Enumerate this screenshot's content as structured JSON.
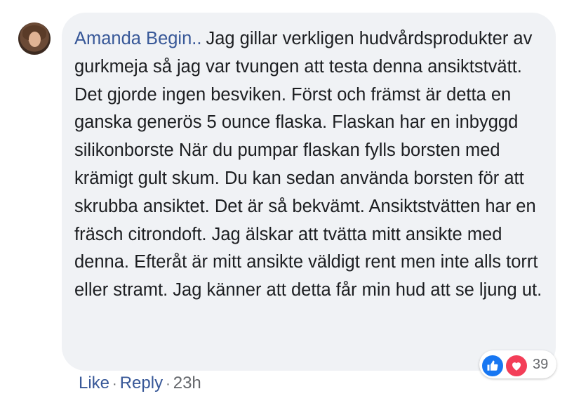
{
  "comment": {
    "author": "Amanda Begin..",
    "text": "Jag gillar verkligen hudvårdsprodukter av gurkmeja så jag var tvungen att testa denna ansiktstvätt. Det gjorde ingen besviken. Först och främst är detta en ganska generös 5 ounce flaska. Flaskan har en inbyggd silikonborste När du pumpar flaskan fylls borsten med krämigt gult skum. Du kan sedan använda borsten för att skrubba ansiktet. Det är så bekvämt. Ansiktstvätten har en fräsch citrondoft. Jag älskar att tvätta mitt ansikte med denna. Efteråt är mitt ansikte väldigt rent men inte alls torrt eller stramt. Jag känner att detta får min hud att se ljung ut."
  },
  "reactions": {
    "icons": [
      "like-icon",
      "love-icon"
    ],
    "count": "39"
  },
  "actions": {
    "like_label": "Like",
    "separator": "·",
    "reply_label": "Reply",
    "timestamp": "23h"
  },
  "colors": {
    "bubble": "#f0f2f5",
    "author": "#385898",
    "text": "#1c1e21",
    "meta": "#65676b",
    "like": "#1877f2",
    "love": "#f33e58"
  }
}
